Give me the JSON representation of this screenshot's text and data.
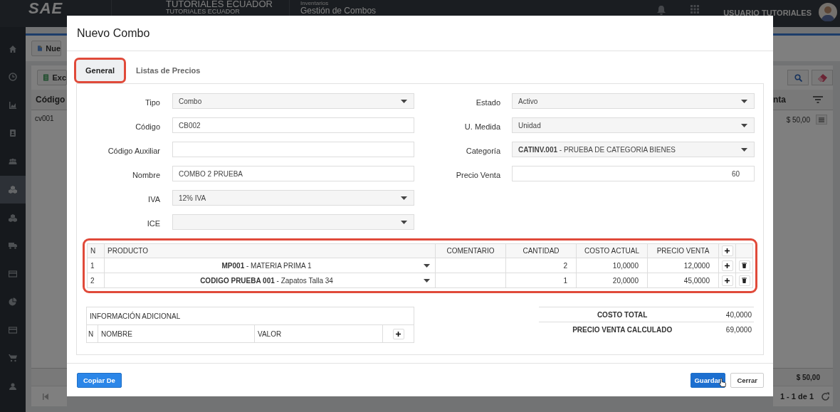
{
  "topbar": {
    "logo": "SAE",
    "company": "TUTORIALES ECUADOR",
    "company_sub": "TUTORIALES ECUADOR",
    "module": "Inventarios",
    "page": "Gestión de Combos",
    "user": "USUARIO TUTORIALES"
  },
  "sidebar": {
    "items": [
      {
        "selected": false
      },
      {
        "selected": false
      },
      {
        "selected": false
      },
      {
        "selected": false
      },
      {
        "selected": false
      },
      {
        "selected": true
      },
      {
        "selected": false
      },
      {
        "selected": false
      },
      {
        "selected": false
      },
      {
        "selected": false
      },
      {
        "selected": false
      },
      {
        "selected": false
      },
      {
        "selected": false
      }
    ]
  },
  "background": {
    "new_button": "Nue",
    "export_button": "Exc",
    "column_1": "Código",
    "column_2": "nta",
    "row_code": "cv001",
    "row_amount": "$ 50,00",
    "footer_amount": "$ 50,00",
    "pagination": "1 - 1 de 1"
  },
  "modal": {
    "title": "Nuevo Combo",
    "tabs": [
      {
        "label": "General",
        "selected": true,
        "highlight": true
      },
      {
        "label": "Listas de Precios",
        "selected": false,
        "highlight": false
      }
    ],
    "left_fields": [
      {
        "label": "Tipo",
        "kind": "select",
        "value": "Combo"
      },
      {
        "label": "Código",
        "kind": "input",
        "value": "CB002"
      },
      {
        "label": "Código Auxiliar",
        "kind": "input"
      },
      {
        "label": "Nombre",
        "kind": "input",
        "value": "COMBO 2 PRUEBA"
      },
      {
        "label": "IVA",
        "kind": "select",
        "value": "12% IVA"
      },
      {
        "label": "ICE",
        "kind": "select"
      }
    ],
    "right_fields": [
      {
        "label": "Estado",
        "kind": "select",
        "value": "Activo"
      },
      {
        "label": "U. Medida",
        "kind": "select",
        "value": "Unidad"
      },
      {
        "label": "Categoría",
        "kind": "select",
        "value": "**CATINV.001** - PRUEBA DE CATEGORIA BIENES"
      },
      {
        "label": "Precio Venta",
        "kind": "number",
        "value": "60"
      }
    ],
    "products": {
      "highlight": true,
      "columns": [
        "N",
        "PRODUCTO",
        "COMENTARIO",
        "CANTIDAD",
        "COSTO ACTUAL",
        "PRECIO VENTA"
      ],
      "rows": [
        {
          "n": "1",
          "product": "**MP001** - MATERIA PRIMA 1",
          "quantity": "2",
          "cost": "10,0000",
          "price": "12,0000"
        },
        {
          "n": "2",
          "product": "**CODIGO PRUEBA 001** - Zapatos Talla 34",
          "quantity": "1",
          "cost": "20,0000",
          "price": "45,0000"
        }
      ]
    },
    "additional_info": {
      "title": "INFORMACIÓN ADICIONAL",
      "columns": [
        "N",
        "NOMBRE",
        "VALOR"
      ]
    },
    "totals": [
      {
        "label": "COSTO TOTAL",
        "value": "40,0000"
      },
      {
        "label": "PRECIO VENTA CALCULADO",
        "value": "69,0000"
      }
    ],
    "buttons": {
      "copy": "Copiar De",
      "save": "Guardar",
      "close": "Cerrar"
    }
  }
}
